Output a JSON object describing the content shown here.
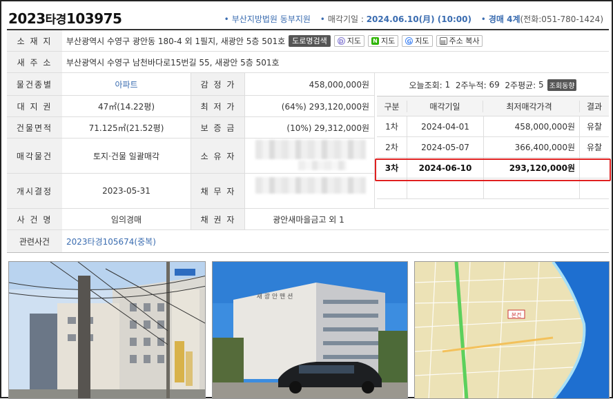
{
  "header": {
    "case_prefix": "2023",
    "case_mid": "타경",
    "case_num": "103975",
    "court": "부산지방법원 동부지원",
    "sale_date_label": "매각기일 : ",
    "sale_date": "2024.06.10(月) (10:00)",
    "division": "경매 4계",
    "phone": "(전화:051-780-1424)"
  },
  "location": {
    "label": "소 재 지",
    "value": "부산광역시 수영구 광안동 180-4 외 1필지, 새광안 5층 501호",
    "buttons": [
      "도로명검색",
      "지도",
      "지도",
      "지도",
      "주소 복사"
    ]
  },
  "new_address": {
    "label": "새 주 소",
    "value": "부산광역시 수영구 남천바다로15번길 55, 새광안 5층 501호"
  },
  "rows": {
    "type_label": "물건종별",
    "type_value": "아파트",
    "appraisal_label": "감 정 가",
    "appraisal_value": "458,000,000원",
    "land_label": "대 지 권",
    "land_value": "47㎡(14.22평)",
    "minbid_label": "최 저 가",
    "minbid_value": "(64%) 293,120,000원",
    "bldg_label": "건물면적",
    "bldg_value": "71.125㎡(21.52평)",
    "deposit_label": "보 증 금",
    "deposit_value": "(10%) 29,312,000원",
    "sale_item_label": "매각물건",
    "sale_item_value": "토지·건물 일괄매각",
    "owner_label": "소 유 자",
    "start_label": "개시결정",
    "start_value": "2023-05-31",
    "debtor_label": "채 무 자",
    "case_name_label": "사 건 명",
    "case_name_value": "임의경매",
    "creditor_label": "채 권 자",
    "creditor_value": "광안새마을금고 외 1",
    "related_label": "관련사건",
    "related_value": "2023타경105674(중복)"
  },
  "views": {
    "today_label": "오늘조회:",
    "today": "1",
    "two_week_label": "2주누적:",
    "two_week": "69",
    "two_week_avg_label": "2주평균:",
    "two_week_avg": "5",
    "trend_button": "조회동향"
  },
  "history": {
    "headers": [
      "구분",
      "매각기일",
      "최저매각가격",
      "결과"
    ],
    "rows": [
      {
        "round": "1차",
        "date": "2024-04-01",
        "price": "458,000,000원",
        "result": "유찰"
      },
      {
        "round": "2차",
        "date": "2024-05-07",
        "price": "366,400,000원",
        "result": "유찰"
      },
      {
        "round": "3차",
        "date": "2024-06-10",
        "price": "293,120,000원",
        "result": ""
      }
    ]
  },
  "photos": {
    "sign_text": "새 광 안 맨 션",
    "map_label": "본건"
  },
  "colors": {
    "accent": "#3a6cb0",
    "highlight": "#e02020"
  }
}
